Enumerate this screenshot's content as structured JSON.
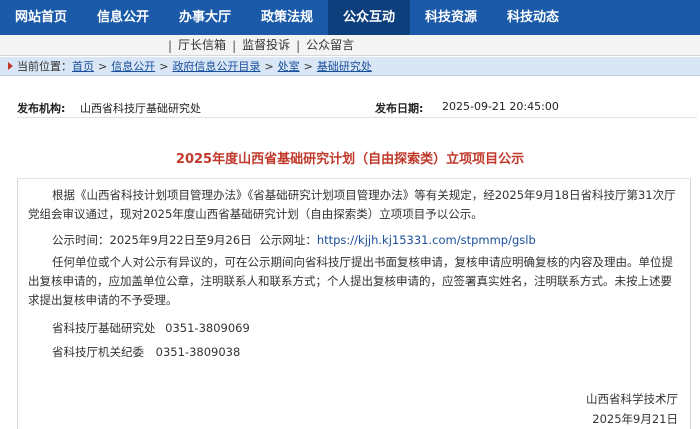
{
  "nav": {
    "items": [
      "网站首页",
      "信息公开",
      "办事大厅",
      "政策法规",
      "公众互动",
      "科技资源",
      "科技动态"
    ],
    "active_index": 4
  },
  "subnav": {
    "items": [
      "厅长信箱",
      "监督投诉",
      "公众留言"
    ]
  },
  "breadcrumb": {
    "prefix": "当前位置：",
    "links": [
      "首页",
      "信息公开",
      "政府信息公开目录",
      "处室",
      "基础研究处"
    ]
  },
  "meta": {
    "org_label": "发布机构:",
    "org_value": "山西省科技厅基础研究处",
    "date_label": "发布日期:",
    "date_value": "2025-09-21 20:45:00"
  },
  "article": {
    "title": "2025年度山西省基础研究计划（自由探索类）立项项目公示",
    "para1": "根据《山西省科技计划项目管理办法》《省基础研究计划项目管理办法》等有关规定，经2025年9月18日省科技厅第31次厅党组会审议通过，现对2025年度山西省基础研究计划（自由探索类）立项项目予以公示。",
    "period_label": "公示时间：",
    "period_value": "2025年9月22日至9月26日",
    "url_label": "公示网址：",
    "url_value": "https://kjjh.kj15331.com/stpmmp/gslb",
    "para3": "任何单位或个人对公示有异议的，可在公示期间向省科技厅提出书面复核申请，复核申请应明确复核的内容及理由。单位提出复核申请的，应加盖单位公章，注明联系人和联系方式；个人提出复核申请的，应签署真实姓名，注明联系方式。未按上述要求提出复核申请的不予受理。",
    "contact1_name": "省科技厅基础研究处",
    "contact1_phone": "0351-3809069",
    "contact2_name": "省科技厅机关纪委",
    "contact2_phone": "0351-3809038",
    "sign_org": "山西省科学技术厅",
    "sign_date": "2025年9月21日"
  },
  "colors": {
    "nav_bg": "#1a5aa8",
    "nav_active_bg": "#0e3f7d",
    "title_red": "#c0392b",
    "link_blue": "#1a4f9c",
    "crumb_bg": "#d9e6f5"
  }
}
